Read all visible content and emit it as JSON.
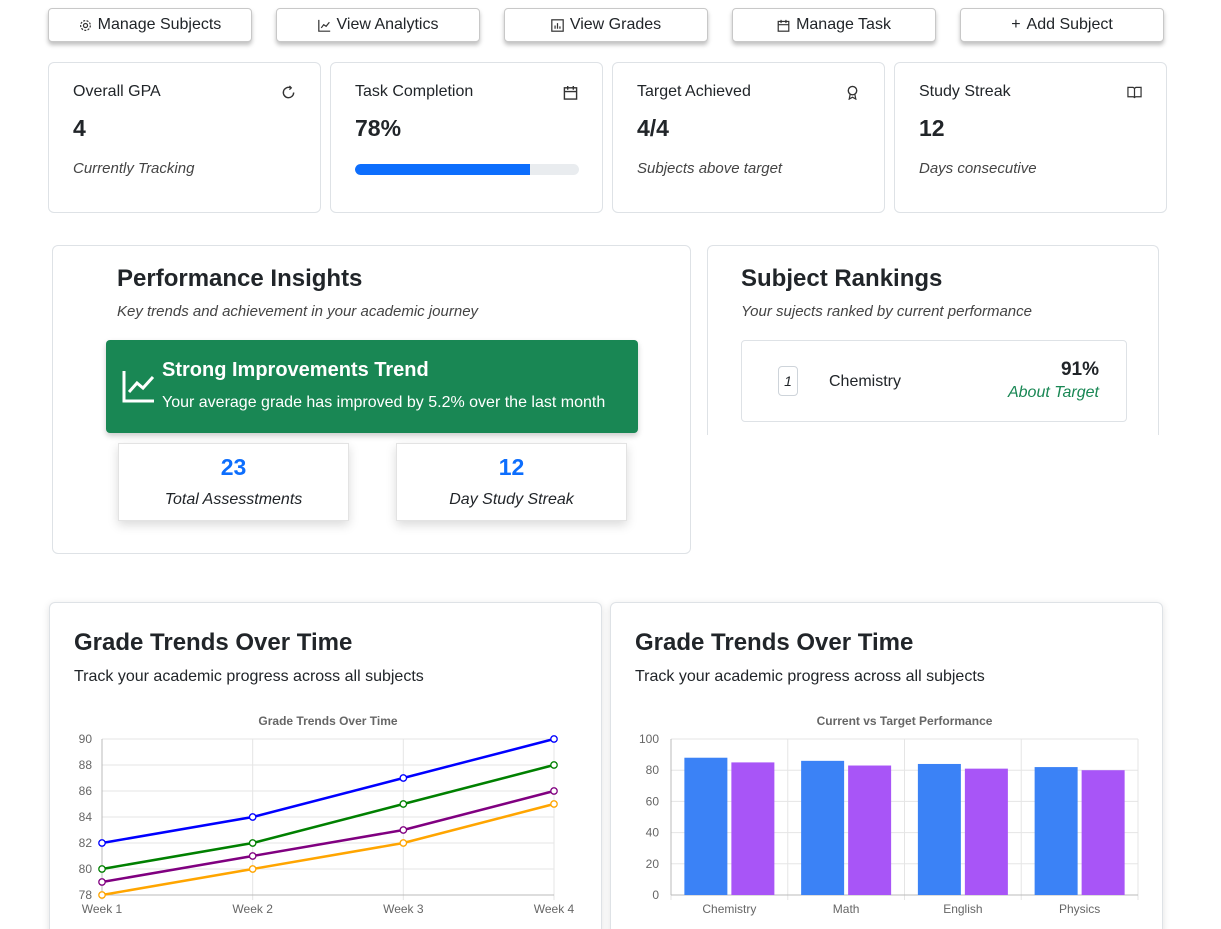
{
  "toolbar": {
    "buttons": [
      {
        "label": "Manage Subjects",
        "icon": "gear-icon"
      },
      {
        "label": "View Analytics",
        "icon": "line-chart-icon"
      },
      {
        "label": "View Grades",
        "icon": "bar-chart-icon"
      },
      {
        "label": "Manage Task",
        "icon": "calendar-icon"
      },
      {
        "label": "Add Subject",
        "icon": "plus-icon",
        "prefix": "+"
      }
    ]
  },
  "stats": [
    {
      "label": "Overall GPA",
      "value": "4",
      "sub": "Currently Tracking",
      "icon": "refresh-icon"
    },
    {
      "label": "Task Completion",
      "value": "78%",
      "progress": 0.78,
      "icon": "calendar-icon"
    },
    {
      "label": "Target Achieved",
      "value": "4/4",
      "sub": "Subjects above target",
      "icon": "award-icon"
    },
    {
      "label": "Study Streak",
      "value": "12",
      "sub": "Days consecutive",
      "icon": "book-icon"
    }
  ],
  "insights": {
    "title": "Performance Insights",
    "subtitle": "Key trends and achievement in your academic journey",
    "trend_title": "Strong Improvements Trend",
    "trend_desc": "Your average grade has improved by 5.2% over the last month",
    "mini": [
      {
        "value": "23",
        "label": "Total Assesstments"
      },
      {
        "value": "12",
        "label": "Day Study Streak"
      }
    ]
  },
  "rankings": {
    "title": "Subject Rankings",
    "subtitle": "Your sujects ranked by current performance",
    "items": [
      {
        "rank": "1",
        "name": "Chemistry",
        "percent": "91%",
        "status": "About Target"
      }
    ]
  },
  "line_card": {
    "title": "Grade Trends Over Time",
    "desc": "Track your academic progress across all subjects"
  },
  "bar_card": {
    "title": "Grade Trends Over Time",
    "desc": "Track your academic progress across all subjects"
  },
  "chart_data": [
    {
      "type": "line",
      "title": "Grade Trends Over Time",
      "categories": [
        "Week 1",
        "Week 2",
        "Week 3",
        "Week 4"
      ],
      "ylim": [
        78,
        90
      ],
      "yticks": [
        78,
        80,
        82,
        84,
        86,
        88,
        90
      ],
      "grid": true,
      "series": [
        {
          "values": [
            82,
            84,
            87,
            90
          ],
          "color": "#0000ff"
        },
        {
          "values": [
            80,
            82,
            85,
            88
          ],
          "color": "#008000"
        },
        {
          "values": [
            79,
            81,
            83,
            86
          ],
          "color": "#800080"
        },
        {
          "values": [
            78,
            80,
            82,
            85
          ],
          "color": "#ffa500"
        }
      ]
    },
    {
      "type": "bar",
      "title": "Current vs Target Performance",
      "categories": [
        "Chemistry",
        "Math",
        "English",
        "Physics"
      ],
      "ylim": [
        0,
        100
      ],
      "yticks": [
        0,
        20,
        40,
        60,
        80,
        100
      ],
      "grid": true,
      "series": [
        {
          "values": [
            88,
            86,
            84,
            82
          ],
          "color": "#3b82f6"
        },
        {
          "values": [
            85,
            83,
            81,
            80
          ],
          "color": "#a855f7"
        }
      ]
    }
  ]
}
